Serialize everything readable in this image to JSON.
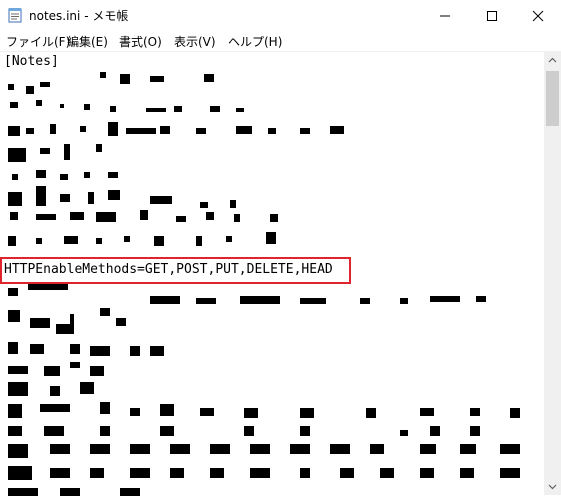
{
  "window": {
    "title": "notes.ini - メモ帳",
    "buttons": {
      "minimize_icon": "minimize-icon",
      "maximize_icon": "maximize-icon",
      "close_icon": "close-icon"
    }
  },
  "menu": {
    "items": [
      {
        "label": "ファイル(F)"
      },
      {
        "label": "編集(E)"
      },
      {
        "label": "書式(O)"
      },
      {
        "label": "表示(V)"
      },
      {
        "label": "ヘルプ(H)"
      }
    ]
  },
  "editor": {
    "first_line": "[Notes]",
    "highlighted_line": "HTTPEnableMethods=GET,POST,PUT,DELETE,HEAD",
    "highlight_color": "#e0242e",
    "content_obscured": true
  },
  "colors": {
    "window_bg": "#ffffff",
    "scrollbar_track": "#f0f0f0",
    "scrollbar_thumb": "#cdcdcd"
  }
}
